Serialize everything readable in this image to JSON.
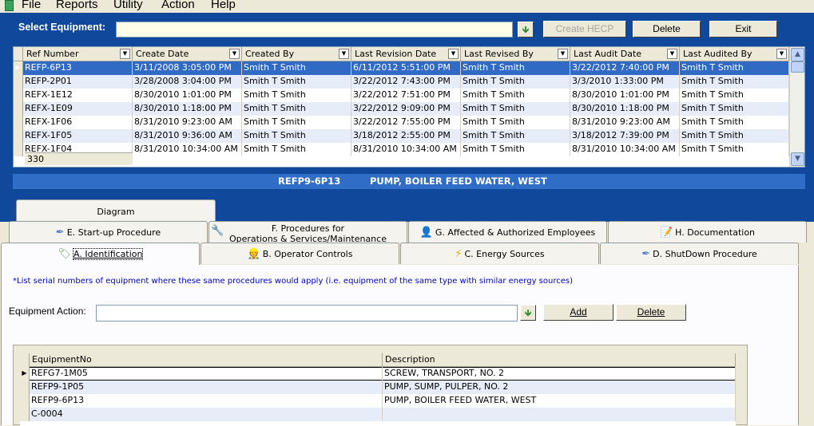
{
  "menu": [
    "File",
    "Reports",
    "Utility",
    "Action",
    "Help"
  ],
  "select_equipment": {
    "label": "Select Equipment:",
    "value": "",
    "buttons": {
      "create_hecp": "Create HECP",
      "delete": "Delete",
      "exit": "Exit"
    }
  },
  "equipment_grid": {
    "columns": [
      "Ref Number",
      "Create Date",
      "Created By",
      "Last Revision Date",
      "Last Revised By",
      "Last Audit Date",
      "Last Audited By"
    ],
    "rows": [
      [
        "REFP-6P13",
        "3/11/2008 3:05:00 PM",
        "Smith T Smith",
        "6/11/2012 5:51:00 PM",
        "Smith T Smith",
        "3/22/2012 7:40:00 PM",
        "Smith T Smith"
      ],
      [
        "REFP-2P01",
        "3/28/2008 3:04:00 PM",
        "Smith T Smith",
        "3/22/2012 7:43:00 PM",
        "Smith T Smith",
        "3/3/2010 1:33:00 PM",
        "Smith T Smith"
      ],
      [
        "REFX-1E12",
        "8/30/2010 1:01:00 PM",
        "Smith T Smith",
        "3/22/2012 7:51:00 PM",
        "Smith T Smith",
        "8/30/2010 1:01:00 PM",
        "Smith T Smith"
      ],
      [
        "REFX-1E09",
        "8/30/2010 1:18:00 PM",
        "Smith T Smith",
        "3/22/2012 9:09:00 PM",
        "Smith T Smith",
        "8/30/2010 1:18:00 PM",
        "Smith T Smith"
      ],
      [
        "REFX-1F06",
        "8/31/2010 9:23:00 AM",
        "Smith T Smith",
        "3/22/2012 7:55:00 PM",
        "Smith T Smith",
        "8/31/2010 9:23:00 AM",
        "Smith T Smith"
      ],
      [
        "REFX-1F05",
        "8/31/2010 9:36:00 AM",
        "Smith T Smith",
        "3/18/2012 2:55:00 PM",
        "Smith T Smith",
        "3/18/2012 7:39:00 PM",
        "Smith T Smith"
      ],
      [
        "REFX-1F04",
        "8/31/2010 10:34:00 AM",
        "Smith T Smith",
        "8/31/2010 10:34:00 AM",
        "Smith T Smith",
        "8/31/2010 10:34:00 AM",
        "Smith T Smith"
      ]
    ],
    "selected_row": 0,
    "count": "330"
  },
  "equipment_banner": {
    "ref": "REFP9-6P13",
    "description": "PUMP, BOILER FEED WATER, WEST"
  },
  "tabs": {
    "row1": [
      {
        "label": "Diagram",
        "icon": ""
      }
    ],
    "row2": [
      {
        "label": "E. Start-up Procedure",
        "icon": "syringe-icon"
      },
      {
        "label": "F. Procedures for\nOperations & Services/Maintenance",
        "icon": "wrench-icon"
      },
      {
        "label": "G. Affected & Authorized Employees",
        "icon": "person-icon"
      },
      {
        "label": "H. Documentation",
        "icon": "document-icon"
      }
    ],
    "row3": [
      {
        "label": "A. Identification",
        "icon": "tag-icon"
      },
      {
        "label": "B. Operator Controls",
        "icon": "operator-icon"
      },
      {
        "label": "C. Energy Sources",
        "icon": "lightning-icon"
      },
      {
        "label": "D. ShutDown Procedure",
        "icon": "syringe-icon"
      }
    ],
    "active": "A. Identification"
  },
  "identification": {
    "hint": "*List serial numbers of equipment where these same procedures would apply (i.e. equipment of the same type with similar energy sources)",
    "equipment_action_label": "Equipment Action:",
    "equipment_action_value": "",
    "add_label": "Add",
    "delete_label": "Delete",
    "grid": {
      "columns": [
        "EquipmentNo",
        "Description"
      ],
      "rows": [
        [
          "REFG7-1M05",
          "SCREW, TRANSPORT, NO. 2"
        ],
        [
          "REFP9-1P05",
          "PUMP, SUMP, PULPER, NO. 2"
        ],
        [
          "REFP9-6P13",
          "PUMP, BOILER FEED WATER, WEST"
        ],
        [
          "C-0004",
          ""
        ]
      ]
    }
  },
  "colors": {
    "panel_blue": "#10499c",
    "banner_blue": "#2f6dc6",
    "selection": "#316ac5",
    "hint_text": "#0000c0"
  }
}
